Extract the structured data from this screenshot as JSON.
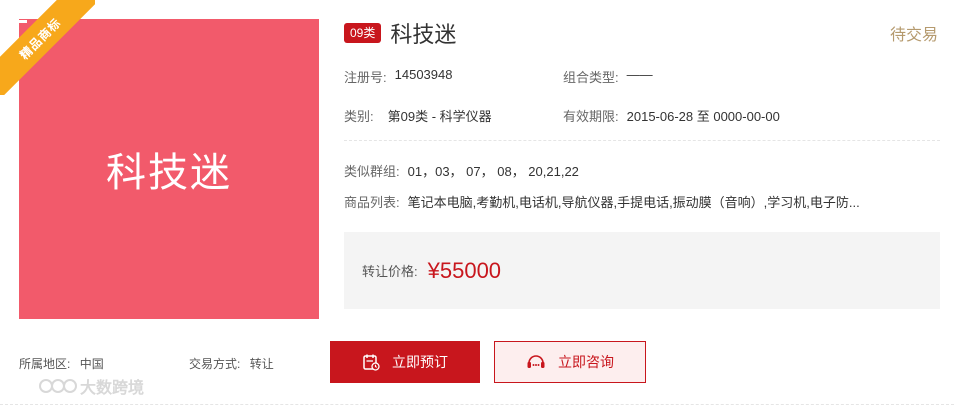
{
  "badge": {
    "label": "精品商标"
  },
  "image": {
    "text": "科技迷",
    "bg_color": "#f25a6b"
  },
  "header": {
    "class_badge": "09类",
    "title": "科技迷",
    "status": "待交易"
  },
  "details": {
    "reg_no_label": "注册号:",
    "reg_no": "14503948",
    "combo_label": "组合类型:",
    "combo": "——",
    "category_label": "类别:",
    "category": "第09类 - 科学仪器",
    "validity_label": "有效期限:",
    "validity": "2015-06-28 至 0000-00-00",
    "similar_label": "类似群组:",
    "similar": "01，03， 07， 08， 20,21,22",
    "goods_label": "商品列表:",
    "goods": "笔记本电脑,考勤机,电话机,导航仪器,手提电话,振动膜（音响）,学习机,电子防..."
  },
  "price": {
    "label": "转让价格:",
    "value": "¥55000"
  },
  "footer": {
    "region_label": "所属地区:",
    "region": "中国",
    "trade_label": "交易方式:",
    "trade": "转让"
  },
  "buttons": {
    "book": "立即预订",
    "consult": "立即咨询"
  },
  "watermark": "大数跨境",
  "colors": {
    "accent": "#c8161d",
    "gold": "#b59a6e",
    "badge_orange": "#f7a81b"
  }
}
